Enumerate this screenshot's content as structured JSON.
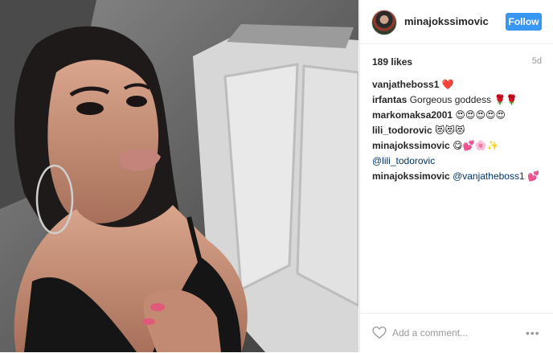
{
  "post": {
    "username": "minajokssimovic",
    "follow_label": "Follow",
    "likes": "189 likes",
    "time": "5d",
    "comments": [
      {
        "user": "vanjatheboss1",
        "text": "❤️",
        "mention": ""
      },
      {
        "user": "irfantas",
        "text": "Gorgeous goddess 🌹🌹",
        "mention": ""
      },
      {
        "user": "markomaksa2001",
        "text": "😍😍😍😍😍",
        "mention": ""
      },
      {
        "user": "lili_todorovic",
        "text": "😻😻😻",
        "mention": ""
      },
      {
        "user": "minajokssimovic",
        "text": "😋💕🌸✨",
        "mention": "@lili_todorovic"
      },
      {
        "user": "minajokssimovic",
        "text": "💕",
        "mention": "@vanjatheboss1"
      }
    ],
    "comment_placeholder": "Add a comment...",
    "more_label": "•••"
  },
  "colors": {
    "follow_button": "#3897f0",
    "mention": "#003569",
    "muted": "#999999"
  }
}
